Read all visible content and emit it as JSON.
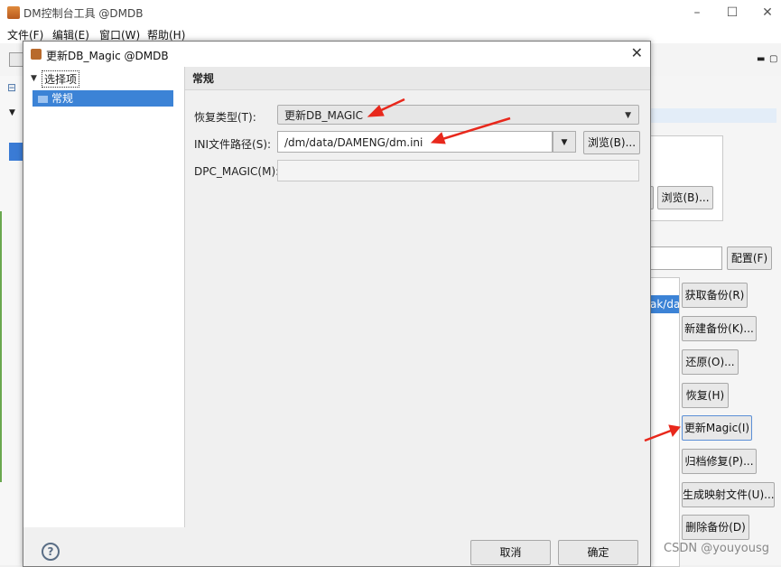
{
  "main": {
    "title": "DM控制台工具 @DMDB",
    "menu": [
      "文件(F)",
      "编辑(E)",
      "窗口(W)",
      "帮助(H)"
    ],
    "list_selected": "ak/dav",
    "buttons": {
      "browse": "浏览(B)...",
      "config": "配置(F)",
      "get_backup": "获取备份(R)",
      "new_backup": "新建备份(K)...",
      "restore": "还原(O)...",
      "recover": "恢复(H)",
      "update_magic": "更新Magic(I)",
      "archive_repair": "归档修复(P)...",
      "gen_map": "生成映射文件(U)...",
      "delete_backup": "删除备份(D)"
    },
    "watermark": "CSDN @youyousg",
    "arrow_color": "#e8281c"
  },
  "dialog": {
    "title": "更新DB_Magic @DMDB",
    "nav": {
      "root": "选择项",
      "item": "常规"
    },
    "section_title": "常规",
    "fields": {
      "restore_type_label": "恢复类型(T):",
      "restore_type_value": "更新DB_MAGIC",
      "ini_path_label": "INI文件路径(S):",
      "ini_path_value": "/dm/data/DAMENG/dm.ini",
      "browse_label": "浏览(B)...",
      "dpc_label": "DPC_MAGIC(M):",
      "dpc_value": ""
    },
    "buttons": {
      "cancel": "取消",
      "ok": "确定"
    }
  }
}
